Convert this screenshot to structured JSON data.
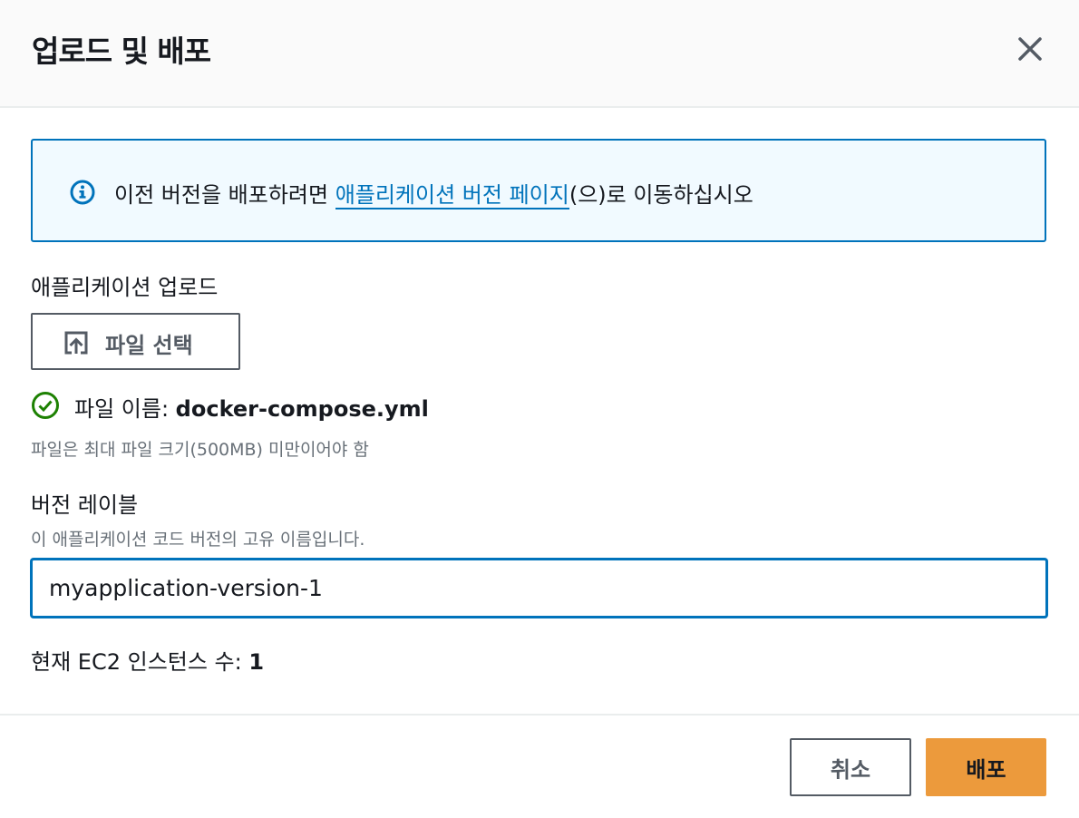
{
  "header": {
    "title": "업로드 및 배포",
    "close_icon": "close-icon"
  },
  "info": {
    "icon": "info-icon",
    "text_before": "이전 버전을 배포하려면 ",
    "link_text": "애플리케이션 버전 페이지",
    "text_after": "(으)로 이동하십시오"
  },
  "upload": {
    "label": "애플리케이션 업로드",
    "button_label": "파일 선택",
    "button_icon": "upload-icon",
    "status_icon": "check-circle-icon",
    "file_name_label": "파일 이름: ",
    "file_name": "docker-compose.yml",
    "constraint": "파일은 최대 파일 크기(500MB) 미만이어야 함"
  },
  "version": {
    "label": "버전 레이블",
    "description": "이 애플리케이션 코드 버전의 고유 이름입니다.",
    "value": "myapplication-version-1"
  },
  "instances": {
    "label": "현재 EC2 인스턴스 수: ",
    "count": "1"
  },
  "footer": {
    "cancel_label": "취소",
    "deploy_label": "배포"
  },
  "colors": {
    "accent": "#0073bb",
    "primary_button": "#ec9a3c",
    "success": "#1d8102"
  }
}
